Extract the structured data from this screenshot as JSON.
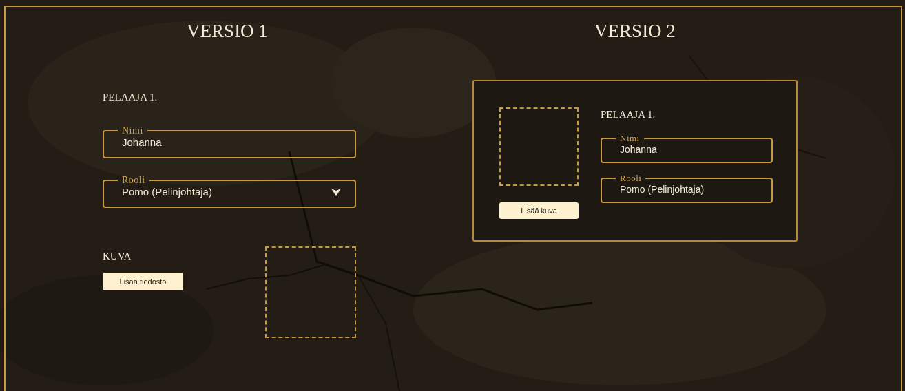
{
  "versions": [
    {
      "title": "VERSIO 1",
      "kind": "stacked",
      "player": {
        "heading": "PELAAJA 1.",
        "fields": [
          {
            "kind": "text",
            "label": "Nimi",
            "value": "Johanna"
          },
          {
            "kind": "select",
            "label": "Rooli",
            "value": "Pomo (Pelinjohtaja)"
          }
        ]
      },
      "image": {
        "heading": "KUVA",
        "button": "Lisää tiedosto"
      }
    },
    {
      "title": "VERSIO 2",
      "kind": "card",
      "player": {
        "heading": "PELAAJA 1.",
        "fields": [
          {
            "kind": "text",
            "label": "Nimi",
            "value": "Johanna"
          },
          {
            "kind": "text",
            "label": "Rooli",
            "value": "Pomo (Pelinjohtaja)"
          }
        ]
      },
      "image": {
        "button": "Lisää kuva"
      }
    }
  ]
}
